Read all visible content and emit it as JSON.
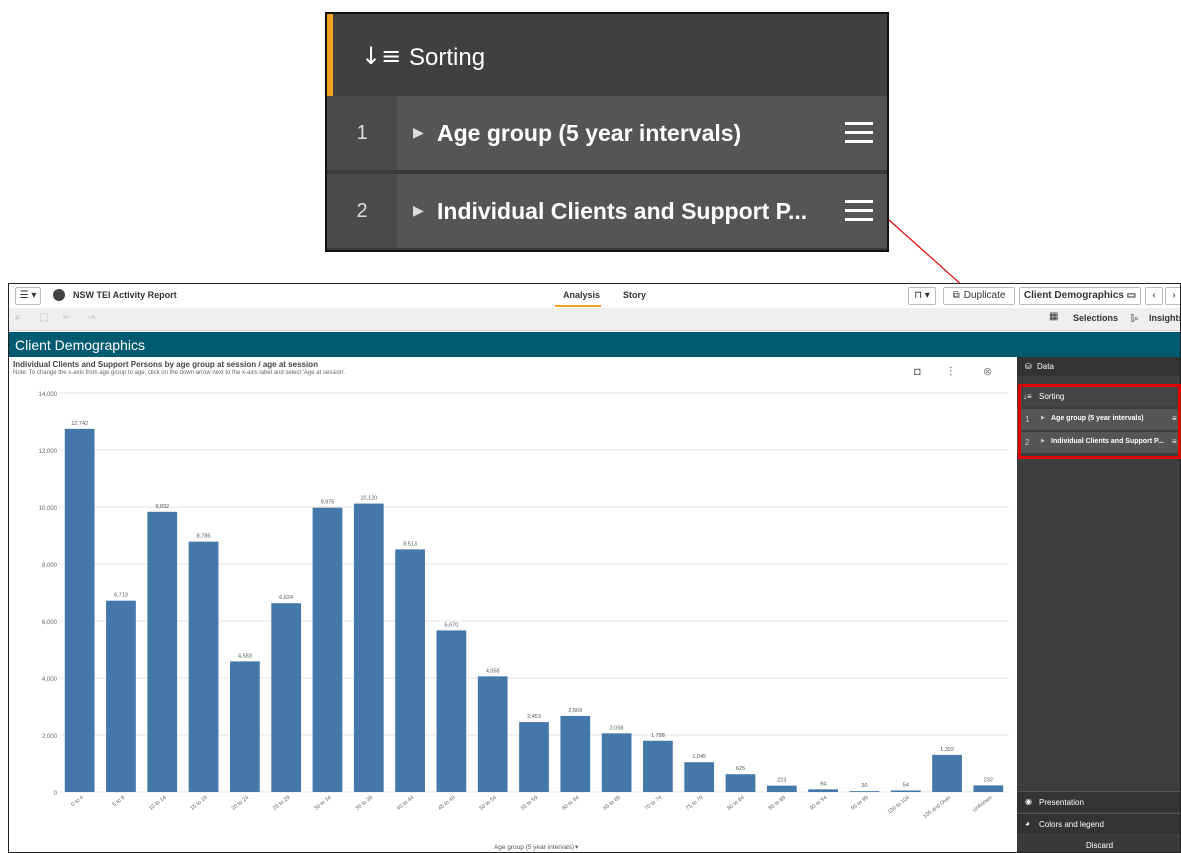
{
  "callout": {
    "sorting_label": "Sorting",
    "sorting_icon": "sort-icon",
    "rows": [
      {
        "num": "1",
        "label": "Age group (5 year intervals)"
      },
      {
        "num": "2",
        "label": "Individual Clients and Support P..."
      }
    ]
  },
  "topbar": {
    "menu_icon": "hamburger-menu-icon",
    "app_icon": "globe-icon",
    "app_title": "NSW TEI Activity Report",
    "tabs": [
      "Analysis",
      "Story"
    ],
    "bookmark_icon": "bookmark-icon",
    "duplicate_label": "Duplicate",
    "sheet_selector": "Client Demographics"
  },
  "toolbar2": {
    "selections_label": "Selections",
    "insights_label": "Insights"
  },
  "sheet": {
    "title": "Client Demographics"
  },
  "chart": {
    "title": "Individual Clients and Support Persons by age group at session / age at session",
    "note": "Note: To change the x-axis from age group to age, click on the down arrow next to the x-axis label and select 'Age at session'."
  },
  "chart_data": {
    "type": "bar",
    "title": "Individual Clients and Support Persons by age group at session / age at session",
    "xlabel": "Age group (5 year intervals)",
    "ylabel": "",
    "ylim": [
      0,
      14000
    ],
    "yticks": [
      "0",
      "2,000",
      "4,000",
      "6,000",
      "8,000",
      "10,000",
      "12,000",
      "14,000"
    ],
    "categories": [
      "0 to 4",
      "5 to 9",
      "10 to 14",
      "15 to 19",
      "20 to 24",
      "25 to 29",
      "30 to 34",
      "35 to 39",
      "40 to 44",
      "45 to 49",
      "50 to 54",
      "55 to 59",
      "60 to 64",
      "65 to 69",
      "70 to 74",
      "75 to 79",
      "80 to 84",
      "85 to 89",
      "90 to 94",
      "95 to 99",
      "100 to 104",
      "105 and Over",
      "Unknown"
    ],
    "values": [
      12742,
      6713,
      9832,
      8785,
      4583,
      6624,
      9975,
      10120,
      8513,
      5670,
      4058,
      2453,
      2669,
      2058,
      1798,
      1045,
      625,
      223,
      94,
      30,
      54,
      1302,
      232
    ],
    "value_labels": [
      "12,742",
      "6,713",
      "9,832",
      "8,785",
      "4,583",
      "6,624",
      "9,975",
      "10,120",
      "8,513",
      "5,670",
      "4,058",
      "2,453",
      "2,669",
      "2,058",
      "1,798",
      "1,045",
      "625",
      "223",
      "94",
      "30",
      "54",
      "1,302",
      "232"
    ],
    "bar_color": "#4477aa",
    "grid": true
  },
  "right_panel": {
    "data_label": "Data",
    "sorting_label": "Sorting",
    "rows": [
      {
        "num": "1",
        "label": "Age group (5 year intervals)"
      },
      {
        "num": "2",
        "label": "Individual Clients and Support P..."
      }
    ],
    "presentation_label": "Presentation",
    "colors_label": "Colors and legend",
    "discard_label": "Discard"
  },
  "colors": {
    "sheet_bar": "#005a72",
    "accent": "#f2a11f",
    "highlight": "#e00000"
  }
}
